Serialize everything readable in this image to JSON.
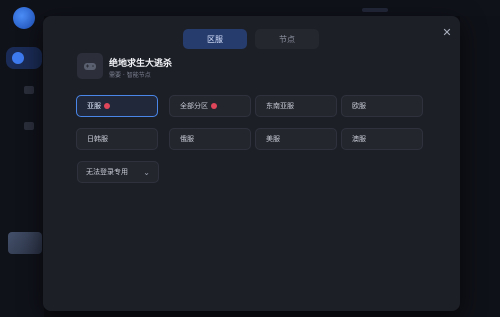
{
  "tabs": [
    {
      "label": "区服",
      "active": true
    },
    {
      "label": "节点",
      "active": false
    }
  ],
  "close_icon": "close-icon",
  "game": {
    "title": "绝地求生大逃杀",
    "subtitle": "需要 · 智能节点",
    "icon": "game-icon"
  },
  "servers": [
    {
      "label": "亚服",
      "hot": true,
      "selected": true
    },
    {
      "label": "全部分区",
      "hot": true,
      "selected": false
    },
    {
      "label": "东南亚服",
      "hot": false,
      "selected": false
    },
    {
      "label": "欧服",
      "hot": false,
      "selected": false
    },
    {
      "label": "日韩服",
      "hot": false,
      "selected": false
    },
    {
      "label": "俄服",
      "hot": false,
      "selected": false
    },
    {
      "label": "美服",
      "hot": false,
      "selected": false
    },
    {
      "label": "澳服",
      "hot": false,
      "selected": false
    }
  ],
  "dropdown": {
    "value": "无法登录专用",
    "icon": "chevron-down-icon"
  },
  "colors": {
    "accent": "#4a86e8",
    "hot_dot": "#e0465a",
    "modal_bg": "#1d1f27"
  }
}
